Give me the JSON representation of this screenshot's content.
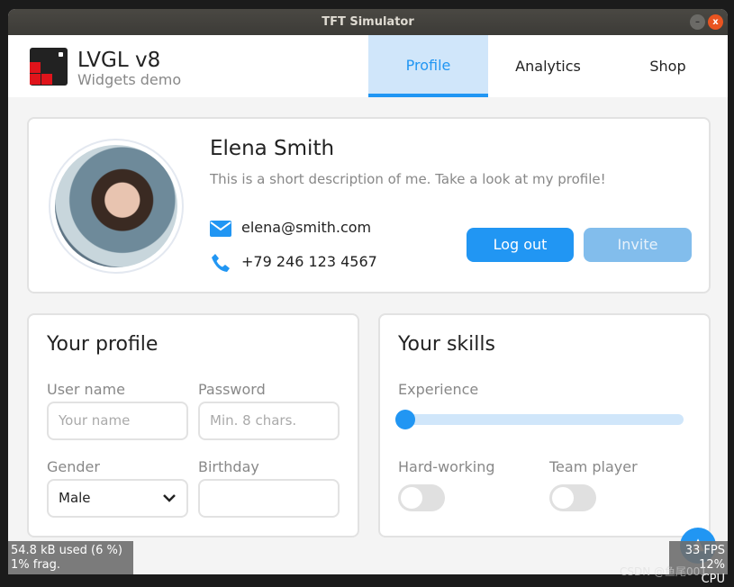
{
  "window": {
    "title": "TFT Simulator"
  },
  "header": {
    "title": "LVGL v8",
    "subtitle": "Widgets demo",
    "tabs": [
      {
        "label": "Profile",
        "active": true
      },
      {
        "label": "Analytics"
      },
      {
        "label": "Shop"
      }
    ]
  },
  "profile": {
    "name": "Elena Smith",
    "description": "This is a short description of me. Take a look at my profile!",
    "email": "elena@smith.com",
    "phone": "+79 246 123 4567",
    "logout_label": "Log out",
    "invite_label": "Invite"
  },
  "your_profile": {
    "title": "Your profile",
    "username_label": "User name",
    "username_placeholder": "Your name",
    "password_label": "Password",
    "password_placeholder": "Min. 8 chars.",
    "gender_label": "Gender",
    "gender_value": "Male",
    "birthday_label": "Birthday",
    "birthday_value": ""
  },
  "your_skills": {
    "title": "Your skills",
    "experience_label": "Experience",
    "experience_value": 0,
    "hardworking_label": "Hard-working",
    "hardworking_on": false,
    "teamplayer_label": "Team player",
    "teamplayer_on": false
  },
  "stats": {
    "mem_line1": "54.8 kB used (6 %)",
    "mem_line2": "1% frag.",
    "fps": "33 FPS",
    "cpu": "12% CPU"
  },
  "watermark": "CSDN @鱼尾001",
  "colors": {
    "accent": "#2196f3",
    "tab_active_bg": "#d0e6fa",
    "invite": "#82bdec",
    "logo_red": "#e0141b"
  }
}
